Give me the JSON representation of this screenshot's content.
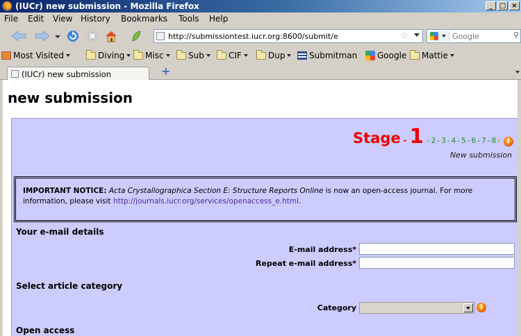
{
  "window": {
    "title": "(IUCr) new submission - Mozilla Firefox",
    "buttons": [
      "_",
      "□",
      "×"
    ]
  },
  "menu": {
    "file": "File",
    "edit": "Edit",
    "view": "View",
    "history": "History",
    "bookmarks": "Bookmarks",
    "tools": "Tools",
    "help": "Help"
  },
  "urlbar": {
    "url": "http://submissiontest.iucr.org:8600/submit/e"
  },
  "search": {
    "placeholder": "Google"
  },
  "bookmarks": [
    {
      "label": "Most Visited",
      "icon": "most-visited-icon",
      "dropdown": true
    },
    {
      "label": "Diving",
      "icon": "folder-icon",
      "dropdown": true
    },
    {
      "label": "Misc",
      "icon": "folder-icon",
      "dropdown": true
    },
    {
      "label": "Sub",
      "icon": "folder-icon",
      "dropdown": true
    },
    {
      "label": "CIF",
      "icon": "folder-icon",
      "dropdown": true
    },
    {
      "label": "Dup",
      "icon": "folder-icon",
      "dropdown": true
    },
    {
      "label": "Submitman",
      "icon": "submitman-icon",
      "dropdown": false
    },
    {
      "label": "Google",
      "icon": "google-icon",
      "dropdown": false
    },
    {
      "label": "Mattie",
      "icon": "folder-icon",
      "dropdown": true
    }
  ],
  "tab": {
    "label": "(IUCr) new submission",
    "new_tab": "+"
  },
  "page": {
    "title": "new submission",
    "stage": {
      "word": "Stage",
      "current": "1",
      "others": [
        "2",
        "3",
        "4",
        "5",
        "6",
        "7",
        "8"
      ],
      "subtitle": "New submission"
    },
    "notice": {
      "bold_prefix": "IMPORTANT NOTICE:",
      "journal": "Acta Crystallographica Section E: Structure Reports Online",
      "text_mid": " is now an open-access journal. For more information, please visit ",
      "link": "http://journals.iucr.org/services/openaccess_e.html",
      "text_end": "."
    },
    "email_section": {
      "heading": "Your e-mail details",
      "email_label": "E-mail address*",
      "email_value": "",
      "repeat_label": "Repeat e-mail address*",
      "repeat_value": ""
    },
    "category_section": {
      "heading": "Select article category",
      "label": "Category",
      "selected": ""
    },
    "open_access": {
      "heading": "Open access"
    }
  }
}
